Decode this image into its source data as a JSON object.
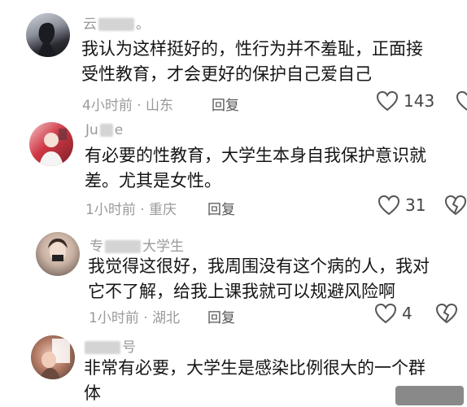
{
  "comments": [
    {
      "name_visible": "云",
      "name_suffix": "。",
      "text_lines": [
        "我认为这样挺好的，性行为并不羞耻，正面接",
        "受性教育，才会更好的保护自己爱自己"
      ],
      "time": "4小时前",
      "location": "山东",
      "reply_label": "回复",
      "likes": "143"
    },
    {
      "name_visible": "Ju",
      "name_suffix": "e",
      "text_lines": [
        "有必要的性教育，大学生本身自我保护意识就",
        "差。尤其是女性。"
      ],
      "time": "1小时前",
      "location": "重庆",
      "reply_label": "回复",
      "likes": "31"
    },
    {
      "name_visible": "专",
      "name_suffix": "大学生",
      "text_lines": [
        "我觉得这很好，我周围没有这个病的人，我对",
        "它不了解，给我上课我就可以规避风险啊"
      ],
      "time": "1小时前",
      "location": "湖北",
      "reply_label": "回复",
      "likes": "4"
    },
    {
      "name_visible": "",
      "name_suffix": "号",
      "text_lines": [
        "非常有必要，大学生是感染比例很大的一个群",
        "体"
      ],
      "time": "",
      "location": "",
      "reply_label": "",
      "likes": ""
    }
  ],
  "separator": " · ",
  "colors": {
    "meta": "#9a9a9a",
    "text": "#151515",
    "icon": "#555555"
  },
  "icons": [
    "heart-icon",
    "broken-heart-icon"
  ]
}
